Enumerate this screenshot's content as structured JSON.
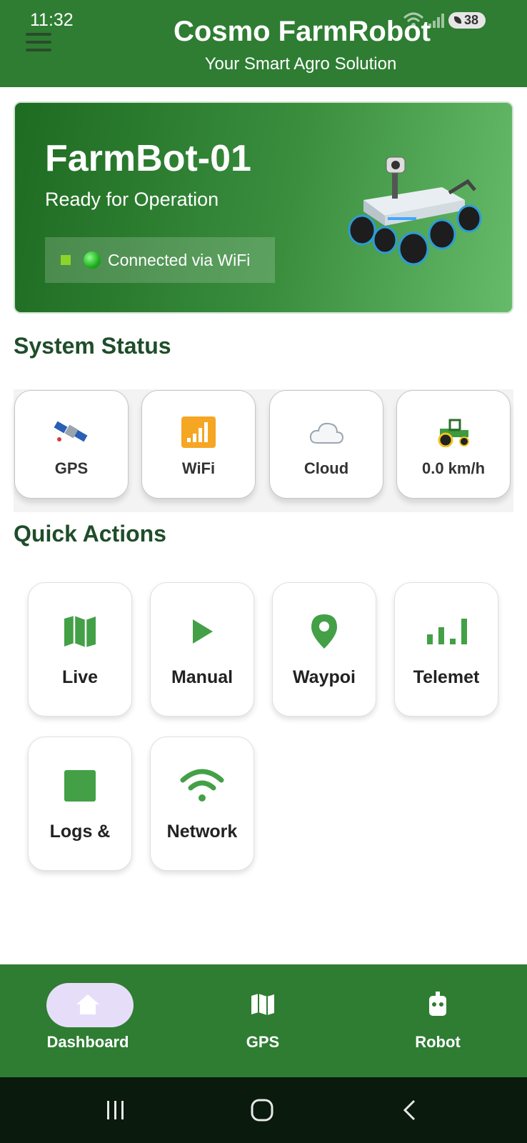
{
  "status_bar": {
    "time": "11:32",
    "battery": "38"
  },
  "header": {
    "title": "Cosmo FarmRobot",
    "subtitle": "Your Smart Agro Solution"
  },
  "hero": {
    "robot_name": "FarmBot-01",
    "robot_status": "Ready for Operation",
    "connection": "Connected via WiFi"
  },
  "system_status": {
    "title": "System Status",
    "items": [
      {
        "label": "GPS",
        "icon": "satellite-icon"
      },
      {
        "label": "WiFi",
        "icon": "signal-bars-icon"
      },
      {
        "label": "Cloud",
        "icon": "cloud-icon"
      },
      {
        "label": "0.0 km/h",
        "icon": "tractor-icon"
      }
    ]
  },
  "quick_actions": {
    "title": "Quick Actions",
    "items": [
      {
        "label": "Live",
        "icon": "map-icon"
      },
      {
        "label": "Manual",
        "icon": "play-icon"
      },
      {
        "label": "Waypoi",
        "icon": "location-pin-icon"
      },
      {
        "label": "Telemet",
        "icon": "bar-chart-icon"
      },
      {
        "label": "Logs &",
        "icon": "square-icon"
      },
      {
        "label": "Network",
        "icon": "wifi-icon"
      }
    ]
  },
  "bottom_nav": {
    "items": [
      {
        "label": "Dashboard",
        "icon": "home-icon",
        "active": true
      },
      {
        "label": "GPS",
        "icon": "map-icon"
      },
      {
        "label": "Robot",
        "icon": "robot-icon"
      }
    ]
  },
  "colors": {
    "primary_green": "#2e7d32",
    "accent_green": "#43a047",
    "nav_pill": "#e6def8",
    "heading": "#1f4d2a"
  }
}
